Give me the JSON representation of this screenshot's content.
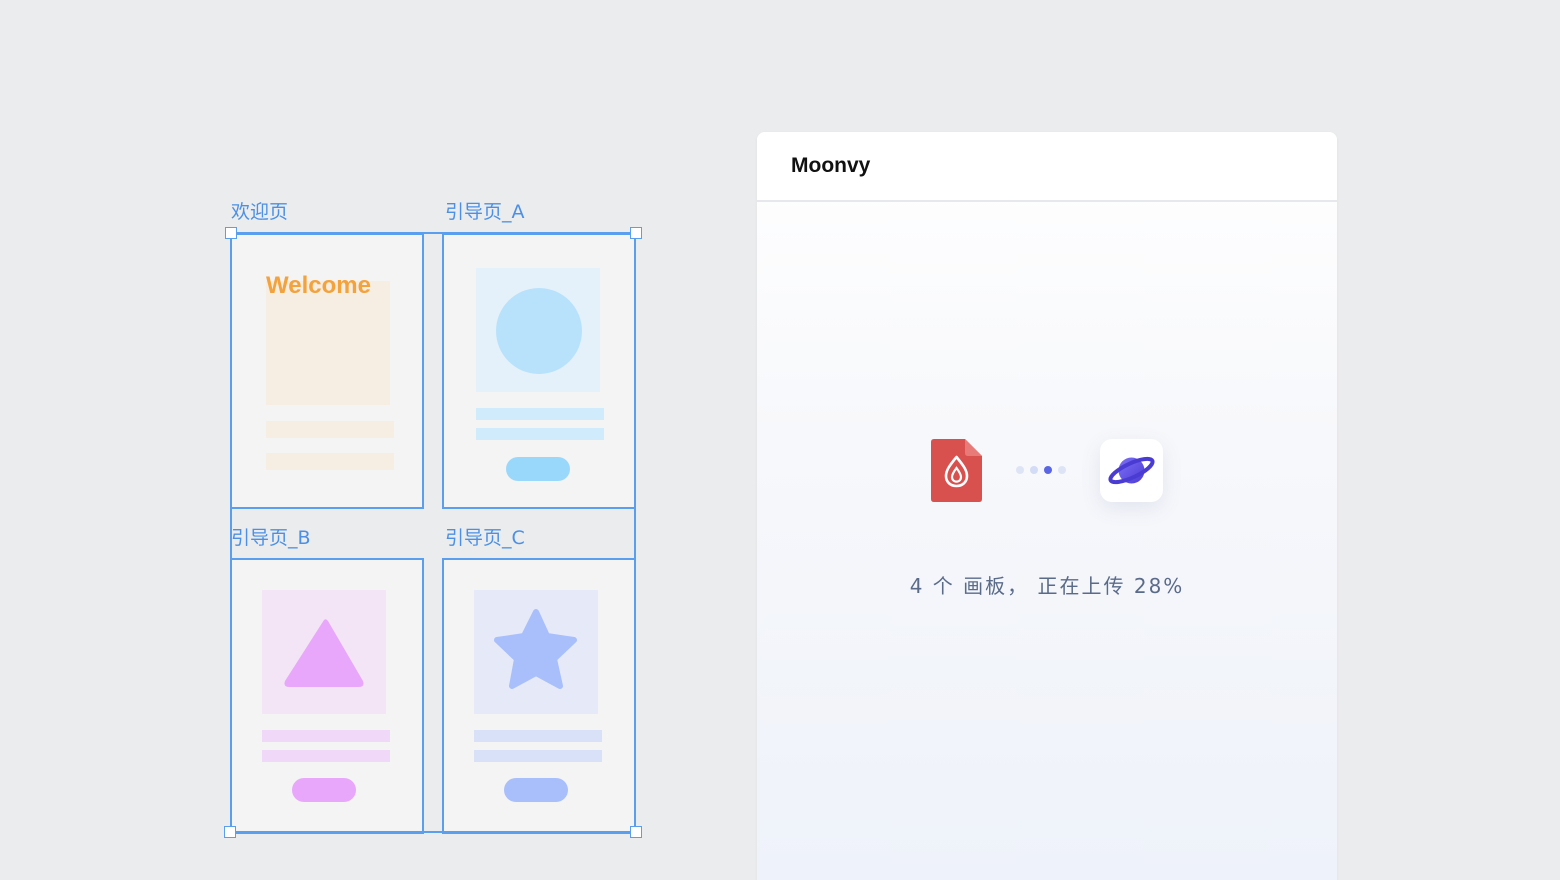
{
  "canvas": {
    "artboards": [
      {
        "label": "欢迎页",
        "hero_text": "Welcome"
      },
      {
        "label": "引导页_A"
      },
      {
        "label": "引导页_B"
      },
      {
        "label": "引导页_C"
      }
    ],
    "colors": {
      "selection": "#5a9ef0",
      "label": "#4b90e6",
      "welcome_orange": "#f4a23c",
      "circle_blue": "#b8e2fb",
      "triangle_purple": "#e8a7fb",
      "star_blue": "#a8bffc"
    }
  },
  "panel": {
    "title": "Moonvy",
    "upload": {
      "count": "4",
      "unit": "个",
      "noun": "画板",
      "separator": "，",
      "action": "正在上传",
      "percent_text": "28%",
      "progress": 0.28
    },
    "icons": {
      "source_file": "red-file-icon",
      "target_app": "planet-icon"
    }
  }
}
